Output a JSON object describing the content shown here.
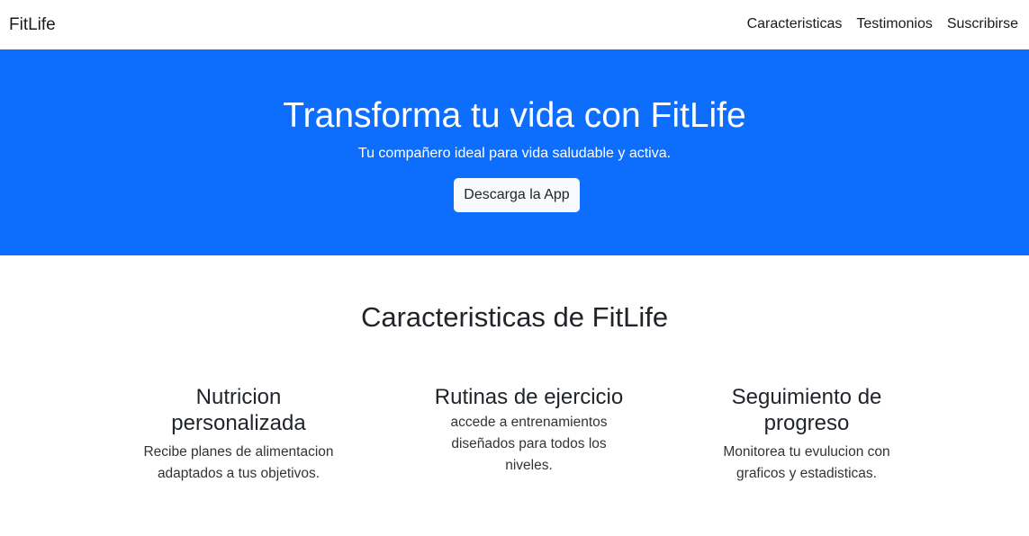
{
  "navbar": {
    "brand": "FitLife",
    "links": [
      "Caracteristicas",
      "Testimonios",
      "Suscribirse"
    ]
  },
  "hero": {
    "title": "Transforma tu vida con FitLife",
    "subtitle": "Tu compañero ideal para vida saludable y activa.",
    "button_label": "Descarga la App",
    "background_color": "#0d6efd"
  },
  "features": {
    "title": "Caracteristicas de FitLife",
    "items": [
      {
        "title": "Nutricion personalizada",
        "text": "Recibe planes de alimentacion adaptados a tus objetivos."
      },
      {
        "title": "Rutinas de ejercicio",
        "text": "accede a entrenamientos diseñados para todos los niveles."
      },
      {
        "title": "Seguimiento de progreso",
        "text": "Monitorea tu evulucion con graficos y estadisticas."
      }
    ]
  }
}
